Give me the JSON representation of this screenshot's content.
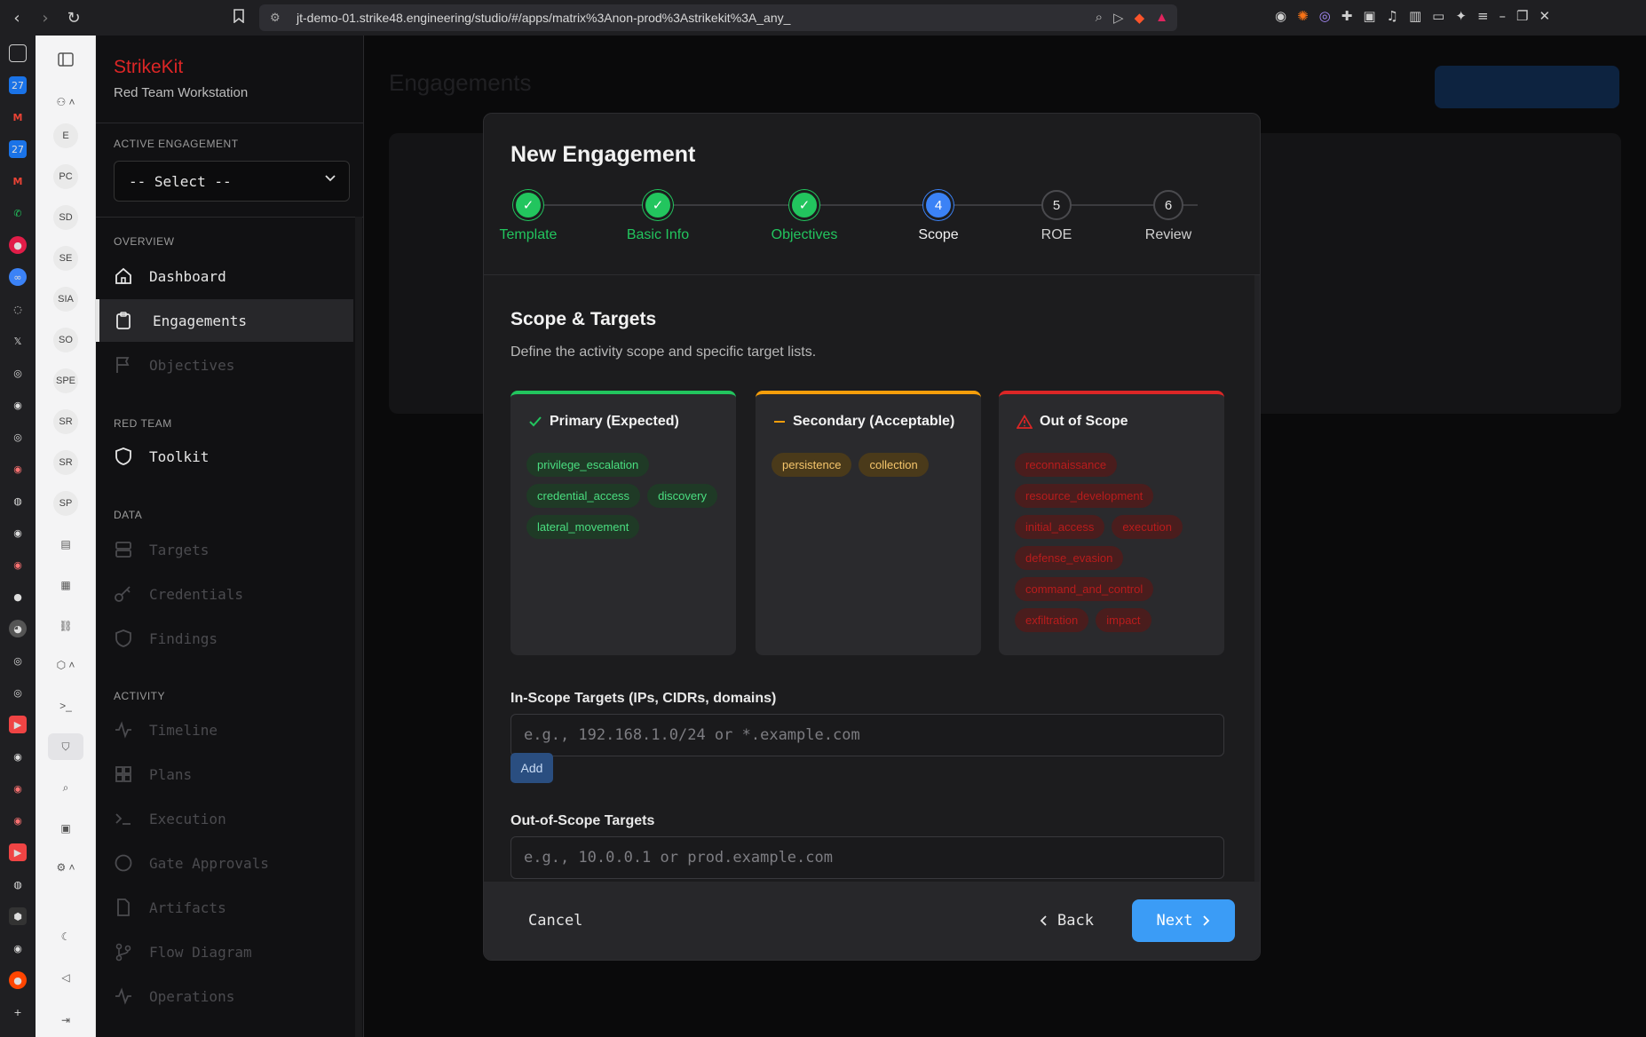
{
  "browser": {
    "url": "jt-demo-01.strike48.engineering/studio/#/apps/matrix%3Anon-prod%3Astrikekit%3A_any_"
  },
  "rail": {
    "items": [
      "E",
      "PC",
      "SD",
      "SE",
      "SIA",
      "SO",
      "SPE",
      "SR",
      "SR",
      "SP"
    ]
  },
  "sidebar": {
    "brand": "StrikeKit",
    "subtitle": "Red Team Workstation",
    "active_engagement_label": "ACTIVE ENGAGEMENT",
    "select_value": "-- Select --",
    "sections": {
      "overview": "OVERVIEW",
      "red_team": "RED TEAM",
      "data": "DATA",
      "activity": "ACTIVITY"
    },
    "nav": {
      "dashboard": "Dashboard",
      "engagements": "Engagements",
      "objectives": "Objectives",
      "toolkit": "Toolkit",
      "targets": "Targets",
      "credentials": "Credentials",
      "findings": "Findings",
      "timeline": "Timeline",
      "plans": "Plans",
      "execution": "Execution",
      "gate_approvals": "Gate Approvals",
      "artifacts": "Artifacts",
      "flow_diagram": "Flow Diagram",
      "operations": "Operations"
    }
  },
  "background": {
    "title": "Engagements"
  },
  "modal": {
    "title": "New Engagement",
    "steps": [
      {
        "num": "1",
        "label": "Template",
        "state": "done"
      },
      {
        "num": "2",
        "label": "Basic Info",
        "state": "done"
      },
      {
        "num": "3",
        "label": "Objectives",
        "state": "done"
      },
      {
        "num": "4",
        "label": "Scope",
        "state": "current"
      },
      {
        "num": "5",
        "label": "ROE",
        "state": "pending"
      },
      {
        "num": "6",
        "label": "Review",
        "state": "pending"
      }
    ],
    "section_title": "Scope & Targets",
    "section_desc": "Define the activity scope and specific target lists.",
    "cards": {
      "primary": {
        "title": "Primary (Expected)",
        "color": "#22c55e",
        "tags": [
          "privilege_escalation",
          "credential_access",
          "discovery",
          "lateral_movement"
        ]
      },
      "secondary": {
        "title": "Secondary (Acceptable)",
        "color": "#f59e0b",
        "tags": [
          "persistence",
          "collection"
        ]
      },
      "out": {
        "title": "Out of Scope",
        "color": "#dc2626",
        "tags": [
          "reconnaissance",
          "resource_development",
          "initial_access",
          "execution",
          "defense_evasion",
          "command_and_control",
          "exfiltration",
          "impact"
        ]
      }
    },
    "in_scope_label": "In-Scope Targets (IPs, CIDRs, domains)",
    "in_scope_placeholder": "e.g., 192.168.1.0/24 or *.example.com",
    "add_label": "Add",
    "out_scope_label": "Out-of-Scope Targets",
    "out_scope_placeholder": "e.g., 10.0.0.1 or prod.example.com",
    "cancel_label": "Cancel",
    "back_label": "Back",
    "next_label": "Next"
  }
}
